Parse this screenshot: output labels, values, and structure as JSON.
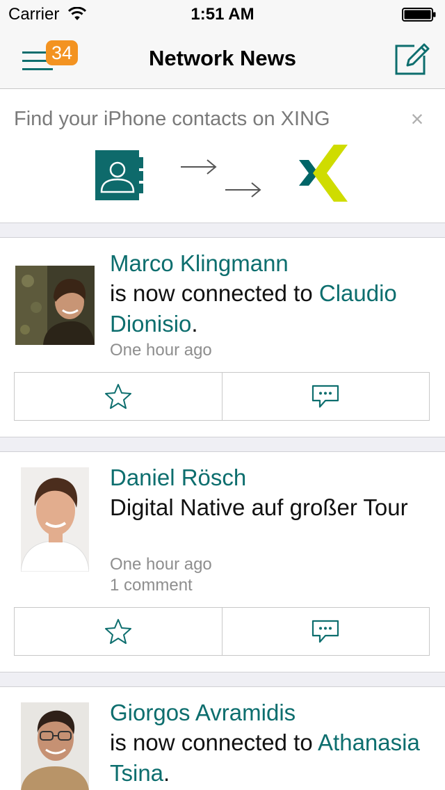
{
  "status_bar": {
    "carrier": "Carrier",
    "time": "1:51 AM"
  },
  "nav": {
    "title": "Network News",
    "badge_count": "34"
  },
  "banner": {
    "text": "Find your iPhone contacts on XING",
    "close_label": "×"
  },
  "colors": {
    "accent": "#0d6e6e",
    "badge": "#f39321",
    "xing_teal": "#006567",
    "xing_green": "#cfdc00"
  },
  "feed": [
    {
      "name": "Marco Klingmann",
      "text_before": "is now connected to ",
      "link_text": "Claudio Dionisio",
      "text_after": ".",
      "time": "One hour ago"
    },
    {
      "name": "Daniel Rösch",
      "text": "Digital Native auf großer Tour",
      "time": "One hour ago",
      "comments": "1 comment"
    },
    {
      "name": "Giorgos Avramidis",
      "text_before": "is now connected to ",
      "link_text": "Athanasia Tsina",
      "text_after": "."
    }
  ]
}
